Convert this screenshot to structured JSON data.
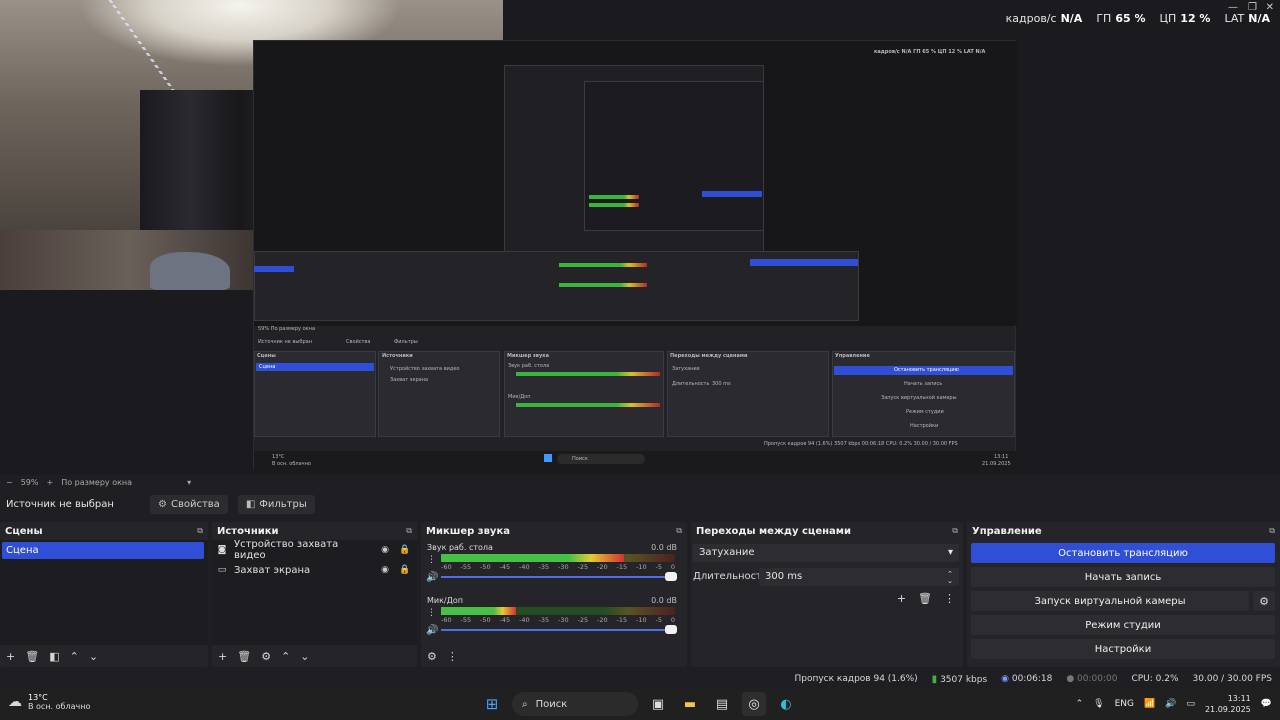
{
  "stats": {
    "fps_label": "кадров/с",
    "fps_value": "N/A",
    "gpu_label": "ГП",
    "gpu_value": "65 %",
    "cpu_label": "ЦП",
    "cpu_value": "12 %",
    "lat_label": "LAT",
    "lat_value": "N/A"
  },
  "zoom": {
    "percent": "59%",
    "fit_label": "По размеру окна"
  },
  "toolbar": {
    "no_source": "Источник не выбран",
    "properties": "Свойства",
    "filters": "Фильтры"
  },
  "scenes": {
    "title": "Сцены",
    "items": [
      "Сцена"
    ]
  },
  "sources": {
    "title": "Источники",
    "items": [
      "Устройство захвата видео",
      "Захват экрана"
    ]
  },
  "mixer": {
    "title": "Микшер звука",
    "channels": [
      {
        "name": "Звук раб. стола",
        "db": "0.0 dB",
        "level": 0.78
      },
      {
        "name": "Мик/Доп",
        "db": "0.0 dB",
        "level": 0.32
      }
    ],
    "ticks": [
      "-60",
      "-55",
      "-50",
      "-45",
      "-40",
      "-35",
      "-30",
      "-25",
      "-20",
      "-15",
      "-10",
      "-5",
      "0"
    ]
  },
  "transitions": {
    "title": "Переходы между сценами",
    "selected": "Затухание",
    "duration_label": "Длительность",
    "duration_value": "300 ms"
  },
  "controls": {
    "title": "Управление",
    "stop_stream": "Остановить трансляцию",
    "start_recording": "Начать запись",
    "virtual_cam": "Запуск виртуальной камеры",
    "studio_mode": "Режим студии",
    "settings": "Настройки"
  },
  "status": {
    "dropped": "Пропуск кадров 94 (1.6%)",
    "bitrate": "3507 kbps",
    "stream_time": "00:06:18",
    "rec_time": "00:00:00",
    "cpu": "CPU: 0.2%",
    "fps": "30.00 / 30.00 FPS"
  },
  "taskbar": {
    "temp": "13°C",
    "weather": "В осн. облачно",
    "search": "Поиск",
    "lang": "ENG",
    "time": "13:11",
    "date": "21.09.2025"
  },
  "mini": {
    "no_source": "Источник не выбран",
    "properties": "Свойства",
    "filters": "Фильтры",
    "scenes": "Сцены",
    "scene": "Сцена",
    "sources": "Источники",
    "src1": "Устройство захвата видео",
    "src2": "Захват экрана",
    "mixer": "Микшер звука",
    "ch1": "Звук раб. стола",
    "ch2": "Мик/Доп",
    "trans": "Переходы между сценами",
    "fade": "Затухание",
    "dur": "Длительность",
    "dur_val": "300 ms",
    "ctrl": "Управление",
    "stop": "Остановить трансляцию",
    "rec": "Начать запись",
    "vcam": "Запуск виртуальной камеры",
    "studio": "Режим студии",
    "settings": "Настройки",
    "zoom": "59%",
    "fit": "По размеру окна",
    "status": "Пропуск кадров 94 (1.6%)   3507 kbps   00:06:18   CPU: 0.2%   30.00 / 30.00 FPS",
    "search": "Поиск",
    "temp": "13°C",
    "weather": "В осн. облачно",
    "time": "13:11",
    "date": "21.09.2025"
  }
}
